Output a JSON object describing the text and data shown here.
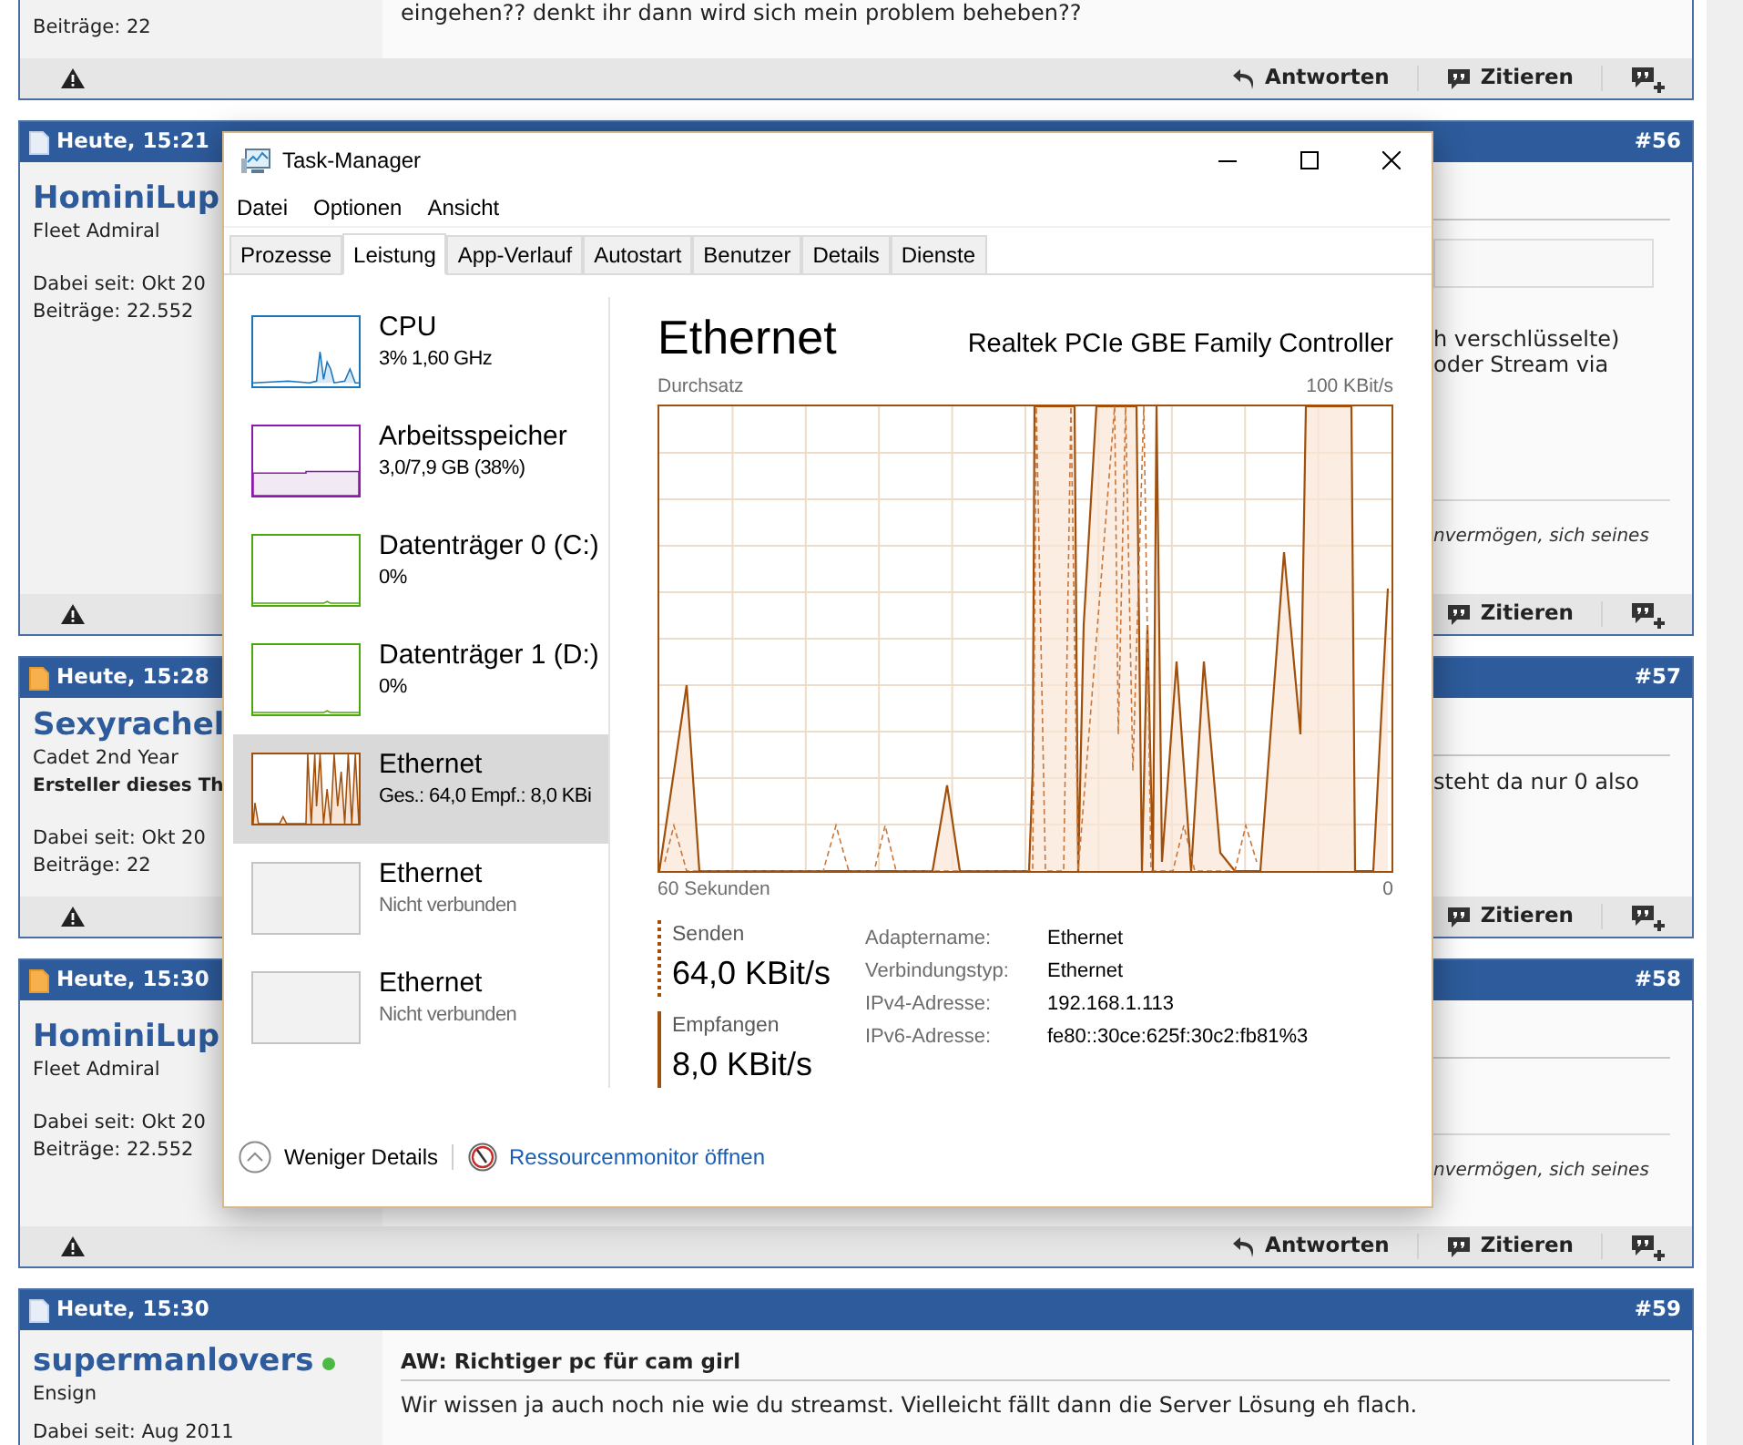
{
  "forum": {
    "posts": [
      {
        "user": {
          "post_count": "Beiträge: 22"
        },
        "lines": [
          "eingehen?? denkt ihr dann wird sich mein problem beheben??"
        ],
        "actions": [
          {
            "kind": "reply",
            "label": "Antworten"
          },
          {
            "kind": "quote",
            "label": "Zitieren"
          },
          {
            "kind": "multiquote"
          }
        ]
      },
      {
        "header": {
          "time": "Heute, 15:21",
          "number": "#56",
          "new": false
        },
        "user": {
          "name": "HominiLup",
          "rank": "Fleet Admiral",
          "joined": "Dabei seit: Okt 20",
          "post_count": "Beiträge: 22.552"
        },
        "quote_box": true,
        "lines": [
          "h verschlüsselte)",
          "oder Stream via"
        ],
        "signature": "nvermögen, sich seines",
        "actions": [
          {
            "kind": "quote",
            "label": "Zitieren"
          },
          {
            "kind": "multiquote"
          }
        ]
      },
      {
        "header": {
          "time": "Heute, 15:28",
          "number": "#57",
          "new": true
        },
        "user": {
          "name": "Sexyrachel",
          "rank": "Cadet 2nd Year",
          "role": "Ersteller dieses Th",
          "joined": "Dabei seit: Okt 20",
          "post_count": "Beiträge: 22"
        },
        "lines": [
          "steht da nur 0 also"
        ],
        "actions": [
          {
            "kind": "quote",
            "label": "Zitieren"
          },
          {
            "kind": "multiquote"
          }
        ]
      },
      {
        "header": {
          "time": "Heute, 15:30",
          "number": "#58",
          "new": true
        },
        "user": {
          "name": "HominiLup",
          "rank": "Fleet Admiral",
          "joined": "Dabei seit: Okt 20",
          "post_count": "Beiträge: 22.552"
        },
        "signature": "nvermögen, sich seines",
        "actions": [
          {
            "kind": "reply",
            "label": "Antworten"
          },
          {
            "kind": "quote",
            "label": "Zitieren"
          },
          {
            "kind": "multiquote"
          }
        ]
      },
      {
        "header": {
          "time": "Heute, 15:30",
          "number": "#59",
          "new": false
        },
        "user": {
          "name": "supermanlovers",
          "online": true,
          "rank": "Ensign",
          "joined": "Dabei seit: Aug 2011"
        },
        "title": "AW: Richtiger pc für cam girl",
        "lines": [
          "Wir wissen ja auch noch nie wie du streamst. Vielleicht fällt dann die Server Lösung eh flach."
        ]
      }
    ]
  },
  "task_manager": {
    "title": "Task-Manager",
    "menu": [
      "Datei",
      "Optionen",
      "Ansicht"
    ],
    "tabs": [
      {
        "label": "Prozesse",
        "selected": false
      },
      {
        "label": "Leistung",
        "selected": true
      },
      {
        "label": "App-Verlauf",
        "selected": false
      },
      {
        "label": "Autostart",
        "selected": false
      },
      {
        "label": "Benutzer",
        "selected": false
      },
      {
        "label": "Details",
        "selected": false
      },
      {
        "label": "Dienste",
        "selected": false
      }
    ],
    "resources": [
      {
        "kind": "cpu",
        "name": "CPU",
        "detail": "3% 1,60 GHz",
        "color": "#1b75bb",
        "selected": false
      },
      {
        "kind": "memory",
        "name": "Arbeitsspeicher",
        "detail": "3,0/7,9 GB (38%)",
        "color": "#8b1aaa",
        "selected": false
      },
      {
        "kind": "disk",
        "name": "Datenträger 0 (C:)",
        "detail": "0%",
        "color": "#4da60c",
        "selected": false
      },
      {
        "kind": "disk",
        "name": "Datenträger 1 (D:)",
        "detail": "0%",
        "color": "#4da60c",
        "selected": false
      },
      {
        "kind": "ethernet",
        "name": "Ethernet",
        "detail": "Ges.: 64,0 Empf.: 8,0 KBi",
        "color": "#a1500c",
        "selected": true
      },
      {
        "kind": "disconnected",
        "name": "Ethernet",
        "detail": "Nicht verbunden",
        "color": "#c4c4c4",
        "selected": false
      },
      {
        "kind": "disconnected",
        "name": "Ethernet",
        "detail": "Nicht verbunden",
        "color": "#c4c4c4",
        "selected": false
      }
    ],
    "detail": {
      "title": "Ethernet",
      "device": "Realtek PCIe GBE Family Controller",
      "graph_label": "Durchsatz",
      "graph_max": "100 KBit/s",
      "graph_span": "60 Sekunden",
      "graph_min": "0",
      "send": {
        "label": "Senden",
        "value": "64,0 KBit/s"
      },
      "receive": {
        "label": "Empfangen",
        "value": "8,0 KBit/s"
      },
      "properties": [
        {
          "label": "Adaptername:",
          "value": "Ethernet"
        },
        {
          "label": "Verbindungstyp:",
          "value": "Ethernet"
        },
        {
          "label": "IPv4-Adresse:",
          "value": "192.168.1.113"
        },
        {
          "label": "IPv6-Adresse:",
          "value": "fe80::30ce:625f:30c2:fb81%3"
        }
      ]
    },
    "footer": {
      "toggle": "Weniger Details",
      "link": "Ressourcenmonitor öffnen"
    }
  }
}
